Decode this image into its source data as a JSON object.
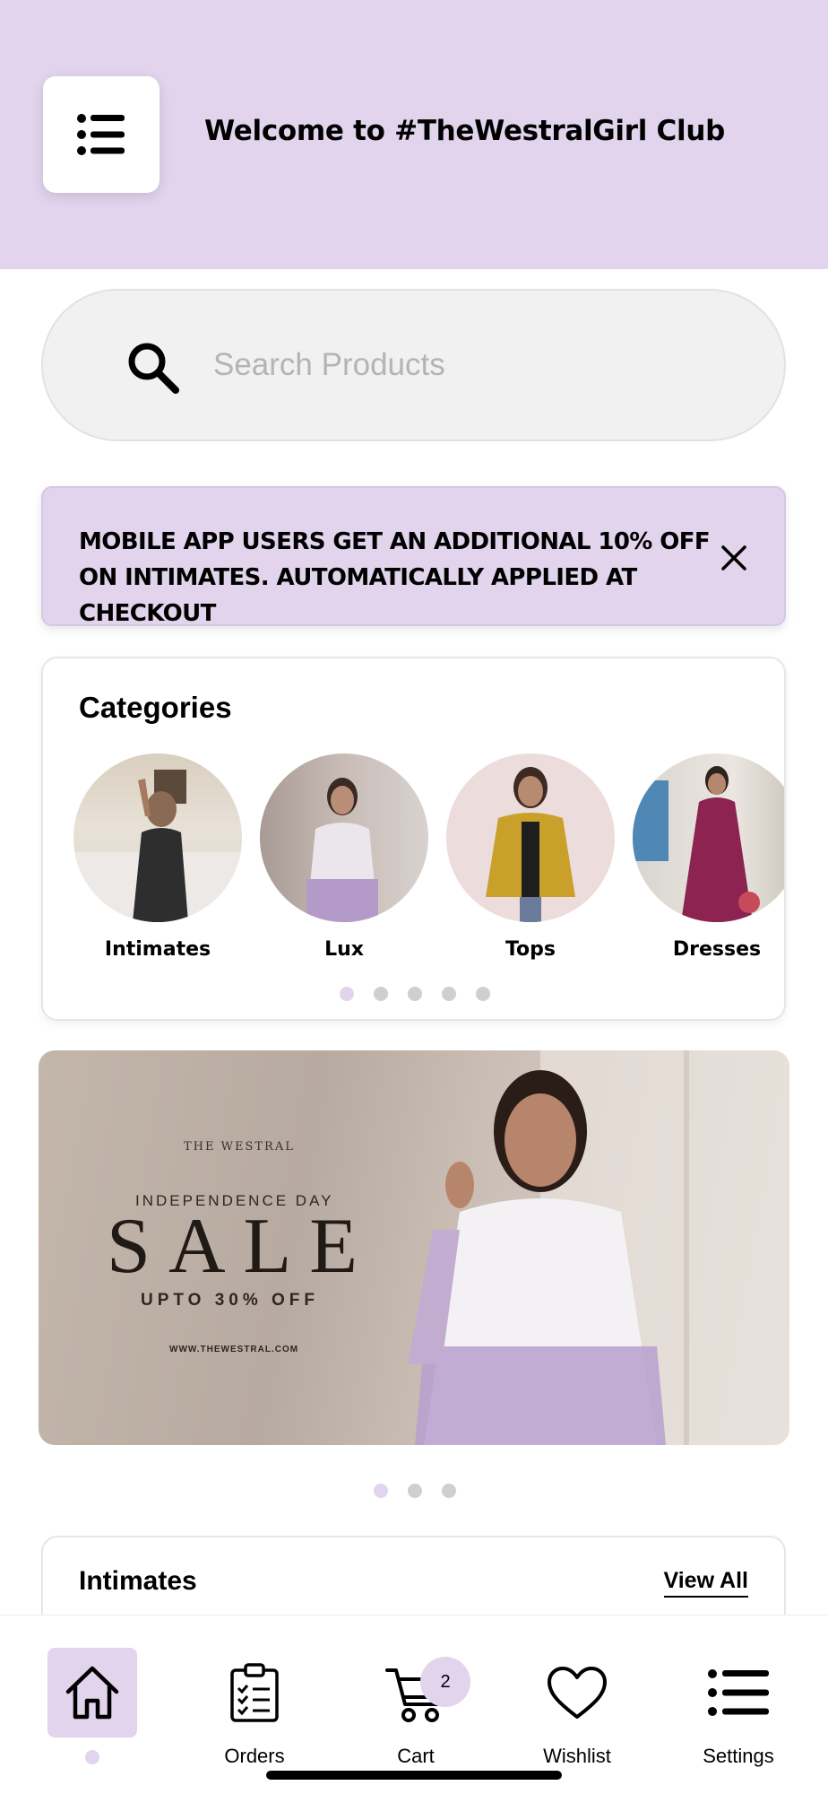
{
  "header": {
    "title": "Welcome to #TheWestralGirl Club",
    "menu_icon": "hamburger-menu-icon"
  },
  "search": {
    "placeholder": "Search Products",
    "icon": "search-icon"
  },
  "promo": {
    "text": "MOBILE APP USERS GET AN ADDITIONAL 10% OFF ON INTIMATES. AUTOMATICALLY APPLIED AT CHECKOUT"
  },
  "categories": {
    "title": "Categories",
    "items": [
      {
        "label": "Intimates"
      },
      {
        "label": "Lux"
      },
      {
        "label": "Tops"
      },
      {
        "label": "Dresses"
      }
    ],
    "dots_count": 5,
    "active_dot": 0
  },
  "banner": {
    "brand": "THE WESTRAL",
    "event": "INDEPENDENCE DAY",
    "headline": "SALE",
    "offer": "UPTO 30% OFF",
    "url": "WWW.THEWESTRAL.COM",
    "dots_count": 3,
    "active_dot": 0
  },
  "section": {
    "title": "Intimates",
    "view_all": "View All"
  },
  "tabbar": {
    "tabs": [
      {
        "label": "",
        "icon": "home-icon",
        "active": true
      },
      {
        "label": "Orders",
        "icon": "clipboard-icon"
      },
      {
        "label": "Cart",
        "icon": "cart-icon",
        "badge": "2"
      },
      {
        "label": "Wishlist",
        "icon": "heart-icon"
      },
      {
        "label": "Settings",
        "icon": "list-icon"
      }
    ]
  },
  "colors": {
    "accent": "#e2d4ec",
    "dot_inactive": "#cfcfcf",
    "search_bg": "#f1f1f1"
  }
}
